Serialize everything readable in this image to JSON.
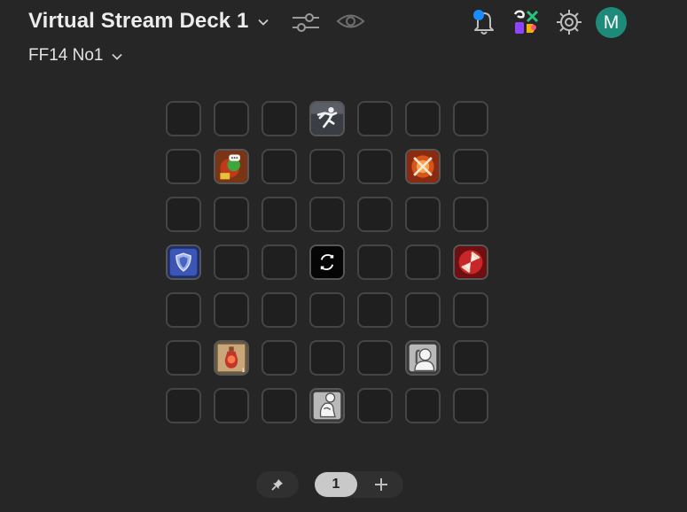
{
  "header": {
    "title": "Virtual Stream Deck 1",
    "profile": "FF14 No1",
    "avatar_letter": "M"
  },
  "icons": {
    "title_dropdown": "chevron-down-icon",
    "settings_sliders": "sliders-icon",
    "visibility": "eye-icon",
    "notifications": "bell-icon",
    "marketplace": "marketplace-icon",
    "settings": "gear-icon",
    "profile_dropdown": "chevron-down-icon",
    "pin": "pin-icon",
    "add_page": "plus-icon"
  },
  "colors": {
    "background": "#262626",
    "avatar": "#1e8a7a",
    "notification_dot": "#1a8cff"
  },
  "grid": {
    "rows": 7,
    "cols": 7,
    "keys": [
      {
        "row": 0,
        "col": 3,
        "icon": "sprint-action-icon"
      },
      {
        "row": 1,
        "col": 1,
        "icon": "emote-speech-action-icon"
      },
      {
        "row": 1,
        "col": 5,
        "icon": "crossed-swords-action-icon"
      },
      {
        "row": 3,
        "col": 0,
        "icon": "shield-action-icon"
      },
      {
        "row": 3,
        "col": 3,
        "icon": "page-switch-icon"
      },
      {
        "row": 3,
        "col": 6,
        "icon": "hourglass-action-icon"
      },
      {
        "row": 5,
        "col": 1,
        "icon": "potion-item-icon"
      },
      {
        "row": 5,
        "col": 5,
        "icon": "emote-think-icon"
      },
      {
        "row": 6,
        "col": 3,
        "icon": "emote-kneel-icon"
      }
    ]
  },
  "pager": {
    "current_page": "1"
  }
}
